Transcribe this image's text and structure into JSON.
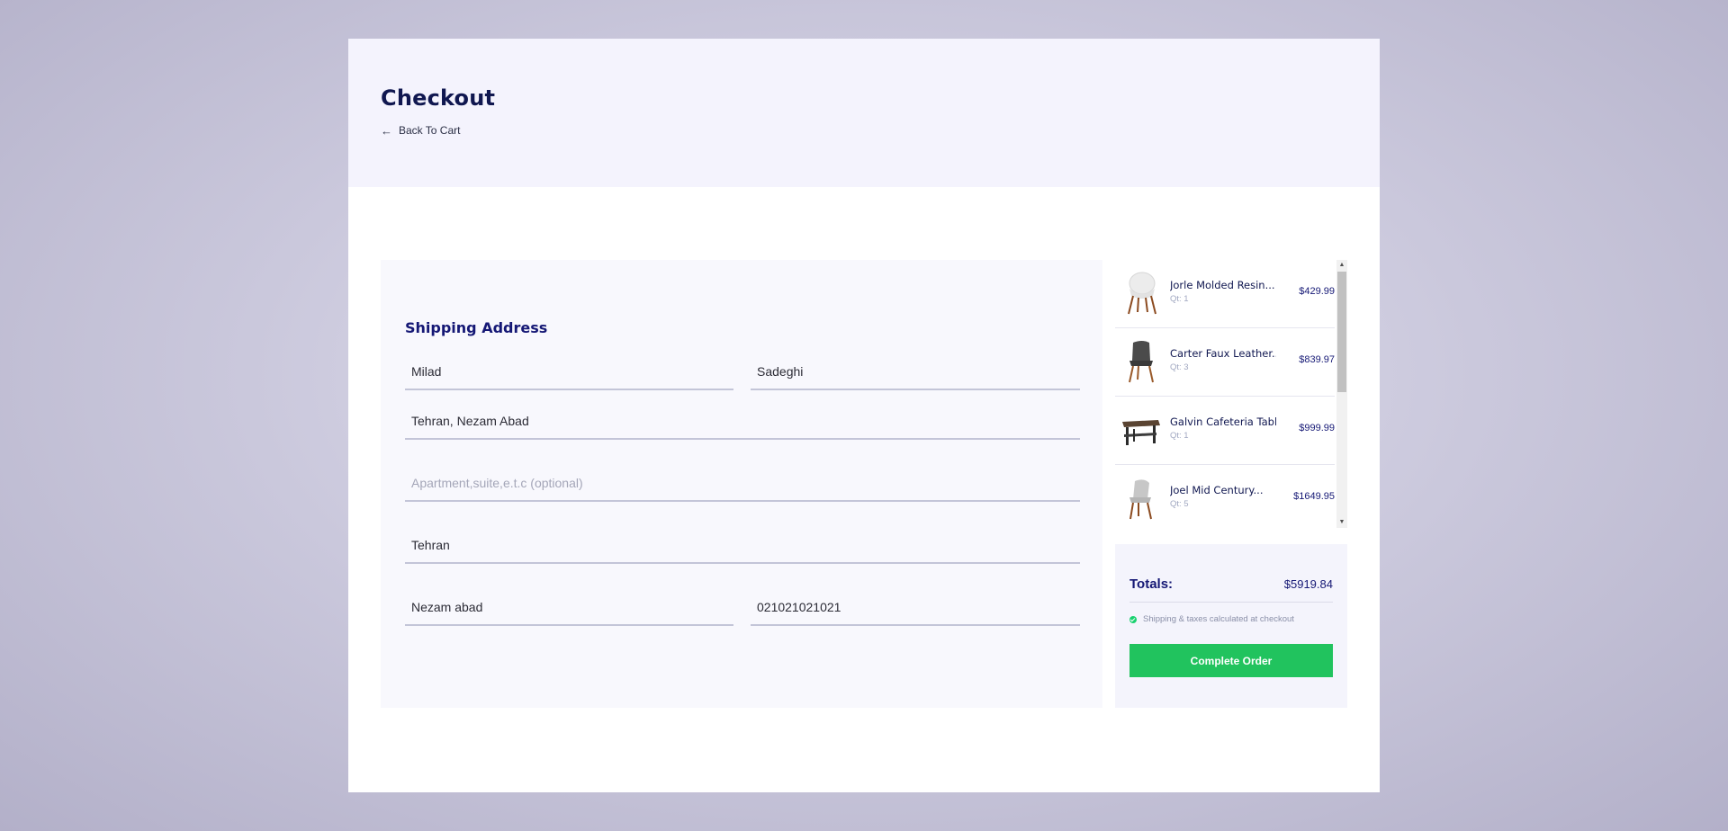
{
  "header": {
    "title": "Checkout",
    "back_label": "Back To Cart"
  },
  "shipping": {
    "heading": "Shipping Address",
    "first_name": "Milad",
    "last_name": "Sadeghi",
    "address": "Tehran, Nezam Abad",
    "apartment_value": "",
    "apartment_placeholder": "Apartment,suite,e.t.c (optional)",
    "city": "Tehran",
    "region": "Nezam abad",
    "phone": "021021021021"
  },
  "cart": {
    "items": [
      {
        "name": "Jorle Molded Resin...",
        "qty": "Qt: 1",
        "price": "$429.99",
        "icon": "chair-white-icon"
      },
      {
        "name": "Carter Faux Leather...",
        "qty": "Qt: 3",
        "price": "$839.97",
        "icon": "chair-dark-icon"
      },
      {
        "name": "Galvin Cafeteria Table",
        "qty": "Qt: 1",
        "price": "$999.99",
        "icon": "table-icon"
      },
      {
        "name": "Joel Mid Century...",
        "qty": "Qt: 5",
        "price": "$1649.95",
        "icon": "chair-grey-icon"
      }
    ]
  },
  "totals": {
    "label": "Totals:",
    "value": "$5919.84",
    "note": "Shipping & taxes calculated at checkout",
    "button_label": "Complete Order"
  },
  "colors": {
    "accent": "#151875",
    "button": "#21c35e",
    "panel": "#f8f8fd"
  }
}
